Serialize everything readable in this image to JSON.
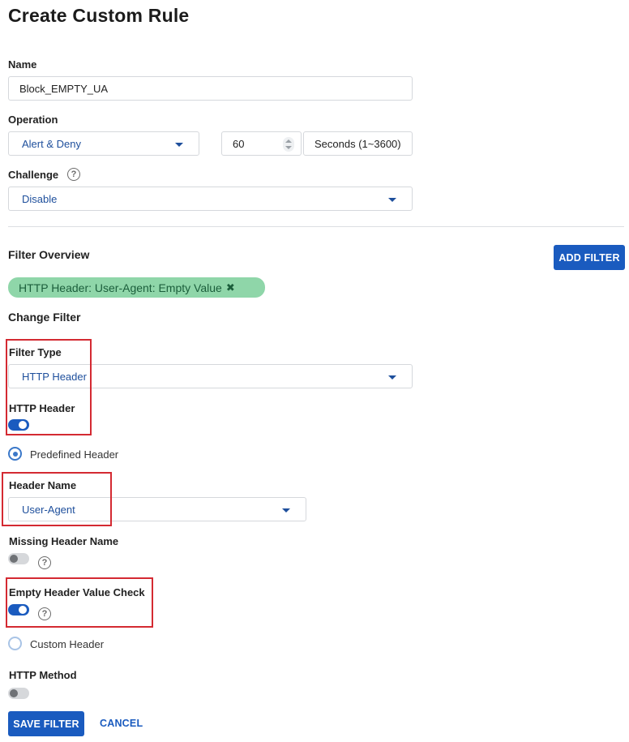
{
  "page": {
    "title": "Create Custom Rule"
  },
  "name_field": {
    "label": "Name",
    "value": "Block_EMPTY_UA"
  },
  "operation": {
    "label": "Operation",
    "selected": "Alert & Deny",
    "duration_value": "60",
    "duration_unit": "Seconds (1~3600)"
  },
  "challenge": {
    "label": "Challenge",
    "help": "?",
    "selected": "Disable"
  },
  "filter_overview": {
    "title": "Filter Overview",
    "add_button": "ADD FILTER",
    "chip": "HTTP Header:  User-Agent: Empty Value",
    "chip_remove": "✖"
  },
  "change_filter": {
    "title": "Change Filter",
    "filter_type": {
      "label": "Filter Type",
      "selected": "HTTP Header"
    },
    "http_header": {
      "label": "HTTP Header",
      "enabled": true
    },
    "predefined_header": {
      "label": "Predefined Header",
      "checked": true
    },
    "header_name": {
      "label": "Header Name",
      "selected": "User-Agent"
    },
    "missing_header_name": {
      "label": "Missing Header Name",
      "enabled": false,
      "help": "?"
    },
    "empty_header_value_check": {
      "label": "Empty Header Value Check",
      "enabled": true,
      "help": "?"
    },
    "custom_header": {
      "label": "Custom Header",
      "checked": false
    },
    "http_method": {
      "label": "HTTP Method",
      "enabled": false
    }
  },
  "footer": {
    "save_label": "SAVE FILTER",
    "cancel_label": "CANCEL"
  },
  "colors": {
    "primary": "#1a5bbf",
    "chip_bg": "#8fd6a9",
    "highlight": "#d42a32"
  }
}
